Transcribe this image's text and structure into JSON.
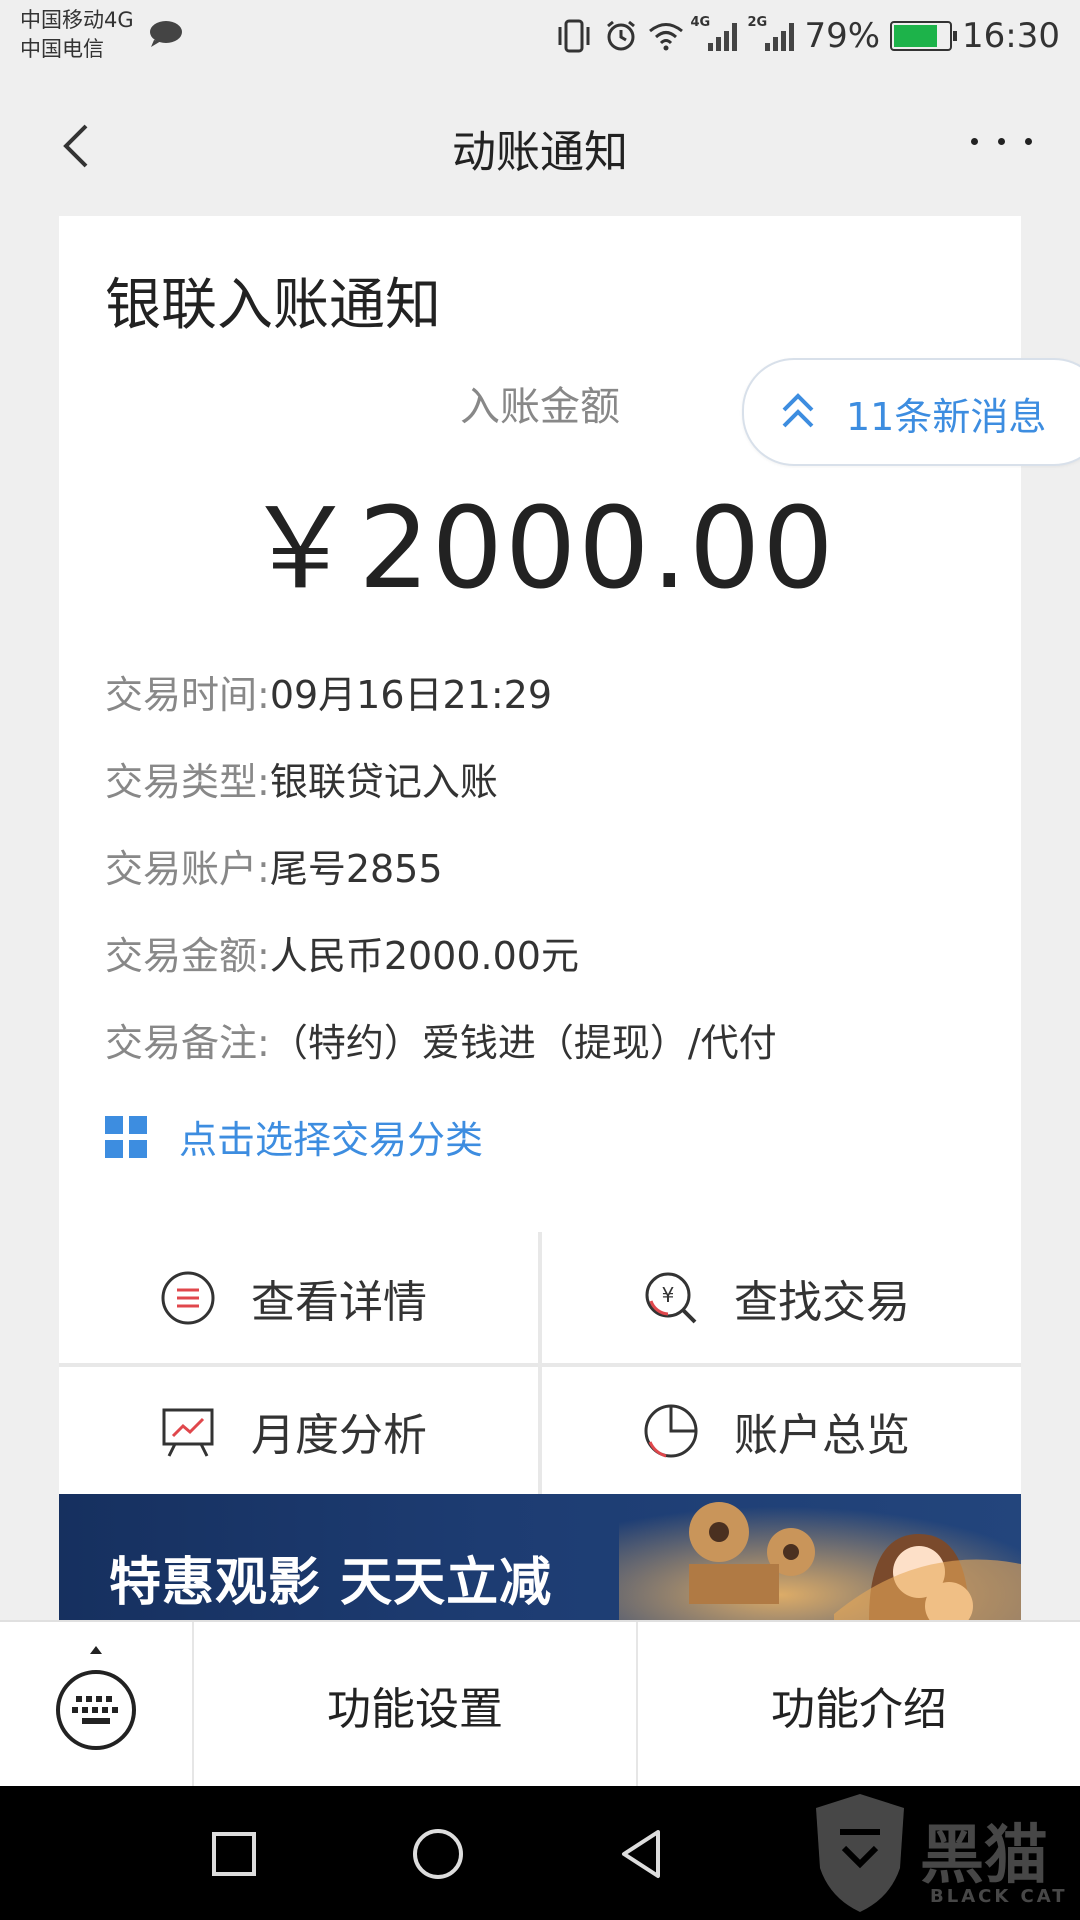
{
  "status_bar": {
    "carrier1": "中国移动4G",
    "carrier2": "中国电信",
    "signal1_tag": "4G",
    "signal2_tag": "2G",
    "battery": "79%",
    "battery_level": 0.79,
    "time": "16:30"
  },
  "nav": {
    "title": "动账通知"
  },
  "card": {
    "title": "银联入账通知",
    "amount_label": "入账金额",
    "amount": "￥2000.00",
    "details": [
      {
        "key": "交易时间:",
        "value": "09月16日21:29"
      },
      {
        "key": "交易类型:",
        "value": "银联贷记入账"
      },
      {
        "key": "交易账户:",
        "value": "尾号2855"
      },
      {
        "key": "交易金额:",
        "value": "人民币2000.00元"
      },
      {
        "key": "交易备注:",
        "value": "（特约）爱钱进（提现）/代付"
      }
    ],
    "category_label": "点击选择交易分类"
  },
  "new_messages": "11条新消息",
  "actions": {
    "view_details": "查看详情",
    "find_transaction": "查找交易",
    "monthly_analysis": "月度分析",
    "account_overview": "账户总览"
  },
  "banner": {
    "text": "特惠观影 天天立减"
  },
  "toolbar": {
    "settings": "功能设置",
    "intro": "功能介绍"
  },
  "watermark": {
    "text": "黑猫",
    "sub": "BLACK CAT"
  },
  "colors": {
    "accent": "#3d8de0",
    "red_icon": "#e0474c",
    "background": "#efefef"
  }
}
